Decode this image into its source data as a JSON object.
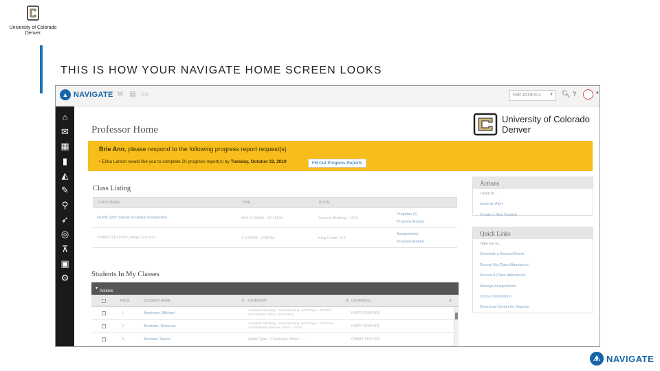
{
  "slide": {
    "logo_line1": "University of Colorado",
    "logo_line2": "Denver",
    "title": "THIS IS HOW YOUR NAVIGATE HOME SCREEN LOOKS",
    "brand": "NAVIGATE"
  },
  "app": {
    "nav_logo": "NAVIGATE",
    "term": "Fall 2019 CU",
    "sidebar_icons": [
      "home-icon",
      "mail-icon",
      "calendar-icon",
      "folder-icon",
      "chart-icon",
      "pin-icon",
      "search-icon",
      "megaphone-icon",
      "pulse-icon",
      "presentation-icon",
      "clipboard-icon",
      "gear-icon"
    ],
    "page_heading": "Professor Home",
    "cu_logo_line1": "University of Colorado",
    "cu_logo_line2": "Denver",
    "alert": {
      "name": "Brie Ann",
      "head_rest": ", please respond to the following progress report request(s)",
      "item_prefix": "Erika Larson would like you to complete 20 progress report(s) by ",
      "item_date": "Tuesday, October 22, 2019",
      "button": "Fill Out Progress Reports"
    },
    "class_listing": {
      "title": "Class Listing",
      "headers": [
        "CLASS NAME",
        "TIME",
        "ROOM"
      ],
      "rows": [
        {
          "name": "HOPR 3200 Survey in Global Perspective",
          "time": "MW 11:00AM - 12:15PM",
          "room": "Science Building - 1032",
          "link1": "Progress (1)",
          "link2": "Progress Report"
        },
        {
          "name": "CMMN 1110 Intro College Success",
          "time": "T 2:00PM - 4:30PM",
          "room": "King Center 212",
          "link1": "Assignments",
          "link2": "Progress Report"
        }
      ]
    },
    "students": {
      "title": "Students In My Classes",
      "actions": "Actions",
      "headers": [
        "ROLE",
        "STUDENT NAME",
        "CATEGORY",
        "COURSE(S)"
      ],
      "rows": [
        {
          "role": "1",
          "name": "Anderson, Michael",
          "category": "Academic Standing - Good Standing, Admit Type - Transfer, International, Minor - Economics",
          "course": "HOPR-3200-001"
        },
        {
          "role": "2",
          "name": "Bowman, Rebecca",
          "category": "Academic Standing - Good Standing, Admit Type - Freshman, Confidentiality Release, Minor - Comm",
          "course": "HOPR-3200-001"
        },
        {
          "role": "3",
          "name": "Burrows, Daniel",
          "category": "Admit Type - Freshman, Minor - ...",
          "course": "CMMN-1110-005"
        }
      ]
    },
    "actions_panel": {
      "title": "Actions",
      "items": [
        "I want to...",
        "Issue an Alert",
        "Create a New Student"
      ]
    },
    "quick_links": {
      "title": "Quick Links",
      "items": [
        "Take me to...",
        "Schedule a General Event",
        "Record My Class Attendance",
        "Record A Class Attendance",
        "Manage Assignments",
        "School Information",
        "Download Center for Reports"
      ]
    }
  }
}
